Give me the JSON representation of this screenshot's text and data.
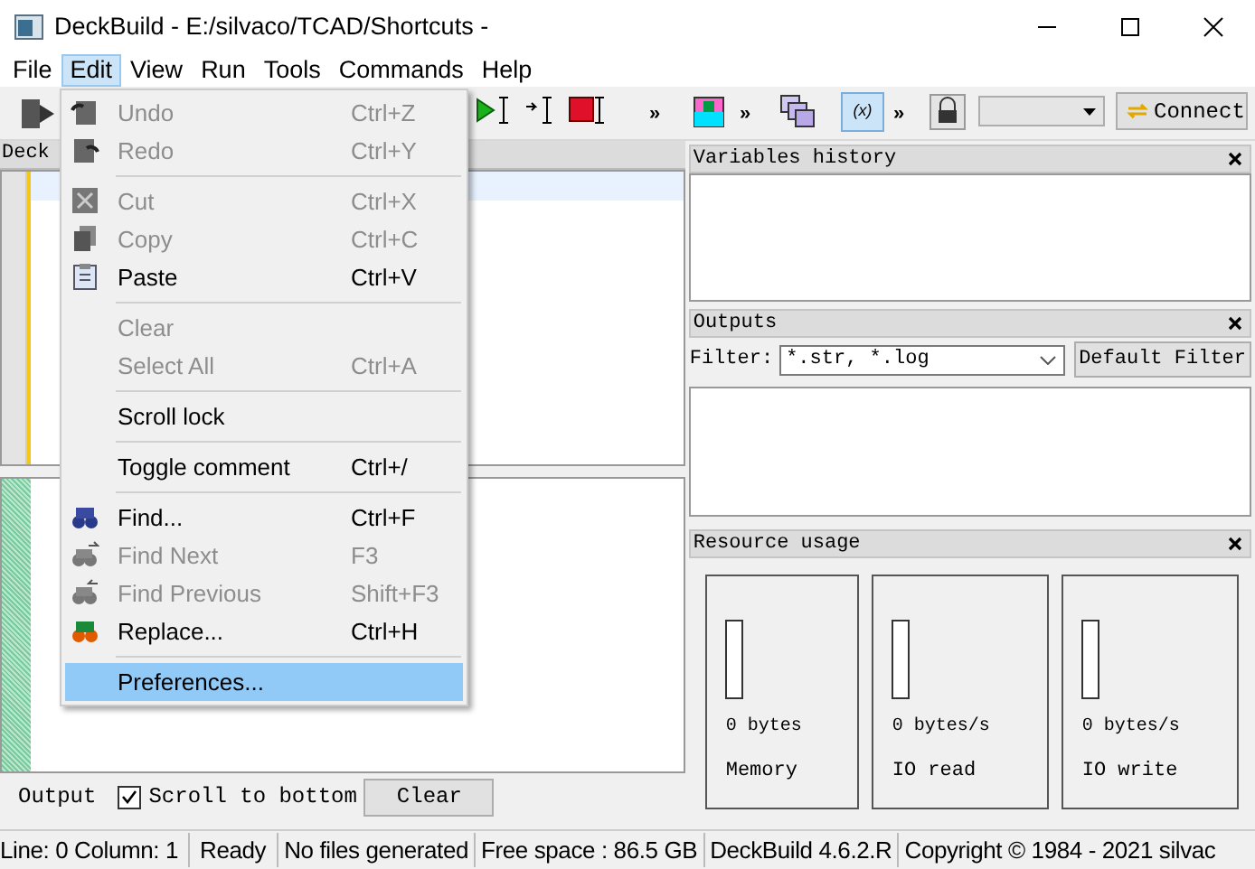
{
  "window": {
    "title": "DeckBuild - E:/silvaco/TCAD/Shortcuts -"
  },
  "menubar": [
    {
      "label": "File",
      "selected": false
    },
    {
      "label": "Edit",
      "selected": true
    },
    {
      "label": "View",
      "selected": false
    },
    {
      "label": "Run",
      "selected": false
    },
    {
      "label": "Tools",
      "selected": false
    },
    {
      "label": "Commands",
      "selected": false
    },
    {
      "label": "Help",
      "selected": false
    }
  ],
  "toolbar": {
    "overflow": [
      "»",
      "»",
      "»"
    ],
    "variables_button": {
      "label": "(x)",
      "selected": true
    }
  },
  "edit_menu": [
    {
      "kind": "item",
      "label": "Undo",
      "shortcut": "Ctrl+Z",
      "disabled": true,
      "selected": false
    },
    {
      "kind": "item",
      "label": "Redo",
      "shortcut": "Ctrl+Y",
      "disabled": true,
      "selected": false
    },
    {
      "kind": "separator"
    },
    {
      "kind": "item",
      "label": "Cut",
      "shortcut": "Ctrl+X",
      "disabled": true,
      "selected": false
    },
    {
      "kind": "item",
      "label": "Copy",
      "shortcut": "Ctrl+C",
      "disabled": true,
      "selected": false
    },
    {
      "kind": "item",
      "label": "Paste",
      "shortcut": "Ctrl+V",
      "disabled": false,
      "selected": false
    },
    {
      "kind": "separator"
    },
    {
      "kind": "item",
      "label": "Clear",
      "disabled": true,
      "selected": false
    },
    {
      "kind": "item",
      "label": "Select All",
      "shortcut": "Ctrl+A",
      "disabled": true,
      "selected": false
    },
    {
      "kind": "separator"
    },
    {
      "kind": "item",
      "label": "Scroll lock",
      "disabled": false,
      "selected": false
    },
    {
      "kind": "separator"
    },
    {
      "kind": "item",
      "label": "Toggle comment",
      "shortcut": "Ctrl+/",
      "disabled": false,
      "selected": false
    },
    {
      "kind": "separator"
    },
    {
      "kind": "item",
      "label": "Find...",
      "shortcut": "Ctrl+F",
      "disabled": false,
      "selected": false
    },
    {
      "kind": "item",
      "label": "Find Next",
      "shortcut": "F3",
      "disabled": true,
      "selected": false
    },
    {
      "kind": "item",
      "label": "Find Previous",
      "shortcut": "Shift+F3",
      "disabled": true,
      "selected": false
    },
    {
      "kind": "item",
      "label": "Replace...",
      "shortcut": "Ctrl+H",
      "disabled": false,
      "selected": false
    },
    {
      "kind": "separator"
    },
    {
      "kind": "item",
      "label": "Preferences...",
      "disabled": false,
      "selected": true
    }
  ],
  "deck_panel": {
    "title": "Deck"
  },
  "output_bar": {
    "label": "Output",
    "scroll_to_bottom": {
      "label": "Scroll to bottom",
      "checked": true
    },
    "clear_button": "Clear"
  },
  "variables_history": {
    "title": "Variables history"
  },
  "outputs": {
    "title": "Outputs",
    "filter_label": "Filter:",
    "filter_value": "*.str, *.log",
    "default_filter_button": "Default Filter"
  },
  "resource_usage": {
    "title": "Resource usage",
    "meters": [
      {
        "reading": "0 bytes",
        "label": "Memory",
        "level": 0
      },
      {
        "reading": "0 bytes/s",
        "label": "IO read",
        "level": 0
      },
      {
        "reading": "0 bytes/s",
        "label": "IO write",
        "level": 0
      }
    ]
  },
  "connect_button": "Connect",
  "status_bar": [
    "Line: 0 Column: 1",
    "Ready",
    "No files generated",
    "Free space : 86.5 GB",
    "DeckBuild 4.6.2.R",
    "Copyright © 1984 - 2021 silvac"
  ]
}
